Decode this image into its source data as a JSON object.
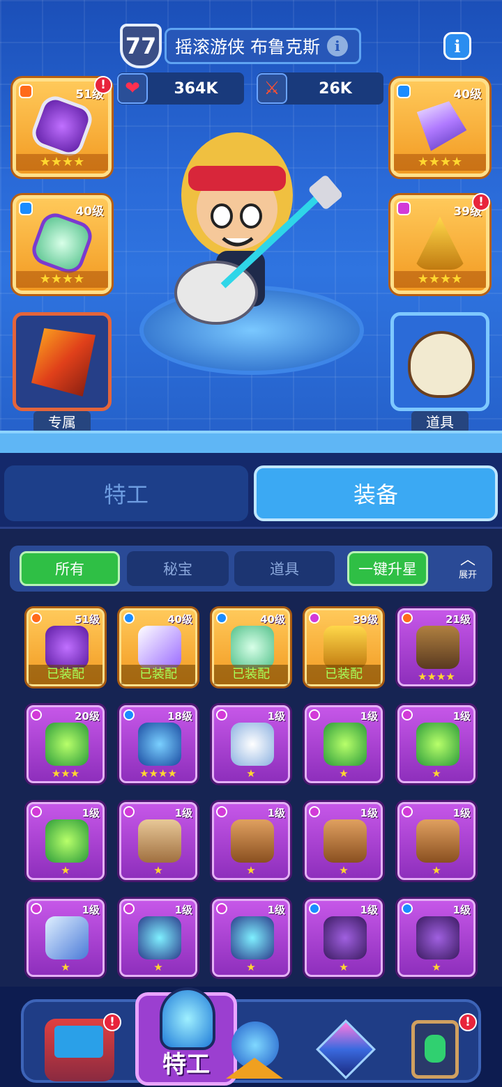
{
  "hero": {
    "level": "77",
    "name": "摇滚游侠 布鲁克斯",
    "info_icon": "info-icon",
    "hp": "364K",
    "atk": "26K"
  },
  "left_slots": [
    {
      "level": "51级",
      "stars": "★★★★",
      "alert": "!"
    },
    {
      "level": "40级",
      "stars": "★★★★"
    },
    {
      "caption": "专属"
    }
  ],
  "right_slots": [
    {
      "level": "40级",
      "stars": "★★★★"
    },
    {
      "level": "39级",
      "stars": "★★★★",
      "alert": "!"
    },
    {
      "caption": "道具"
    }
  ],
  "tabs": {
    "agent": "特工",
    "equipment": "装备"
  },
  "filters": {
    "all": "所有",
    "treasure": "秘宝",
    "items": "道具",
    "upgrade": "一键升星",
    "expand": "展开"
  },
  "equipped_label": "已装配",
  "grid": [
    {
      "level": "51级",
      "equipped": true,
      "stars": ""
    },
    {
      "level": "40级",
      "equipped": true,
      "stars": ""
    },
    {
      "level": "40级",
      "equipped": true,
      "stars": ""
    },
    {
      "level": "39级",
      "equipped": true,
      "stars": ""
    },
    {
      "level": "21级",
      "equipped": false,
      "stars": "★★★★"
    },
    {
      "level": "20级",
      "stars": "★★★"
    },
    {
      "level": "18级",
      "stars": "★★★★"
    },
    {
      "level": "1级",
      "stars": "★"
    },
    {
      "level": "1级",
      "stars": "★"
    },
    {
      "level": "1级",
      "stars": "★"
    },
    {
      "level": "1级",
      "stars": "★"
    },
    {
      "level": "1级",
      "stars": "★"
    },
    {
      "level": "1级",
      "stars": "★"
    },
    {
      "level": "1级",
      "stars": "★"
    },
    {
      "level": "1级",
      "stars": "★"
    },
    {
      "level": "1级",
      "stars": "★"
    },
    {
      "level": "1级",
      "stars": "★"
    },
    {
      "level": "1级",
      "stars": "★"
    },
    {
      "level": "1级",
      "stars": "★"
    },
    {
      "level": "1级",
      "stars": "★"
    }
  ],
  "nav": {
    "selected_label": "特工",
    "alert": "!"
  }
}
